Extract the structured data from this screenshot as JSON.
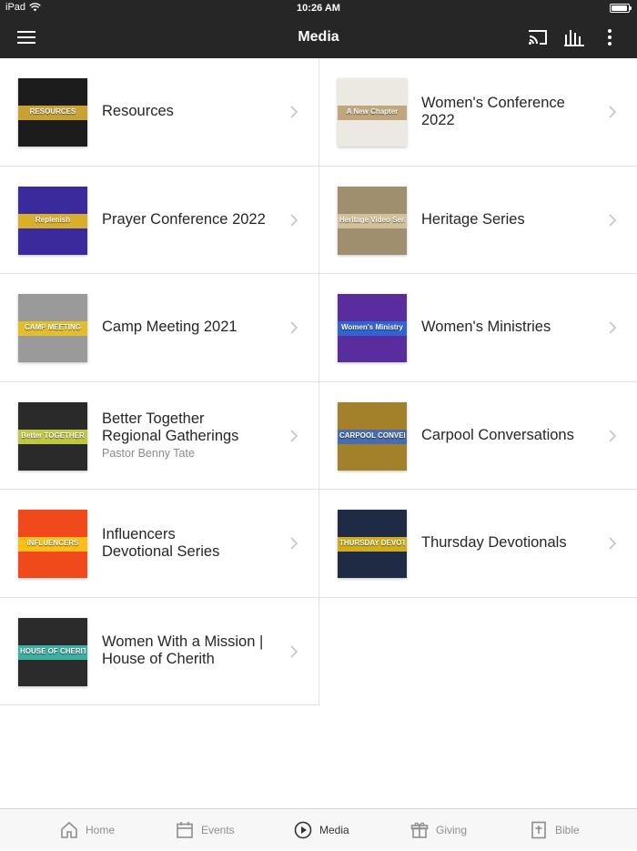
{
  "status": {
    "device": "iPad",
    "time": "10:26 AM"
  },
  "nav": {
    "title": "Media"
  },
  "left_items": [
    {
      "title": "Resources",
      "thumb_text": "RESOURCES",
      "thumb_bg": "#1c1c1c",
      "thumb_accent": "#e8b93a"
    },
    {
      "title": "Prayer Conference 2022",
      "thumb_text": "Replenish",
      "thumb_bg": "#3b2a9c",
      "thumb_accent": "#f5c61a"
    },
    {
      "title": "Camp Meeting 2021",
      "thumb_text": "CAMP MEETING",
      "thumb_bg": "#9a9a9a",
      "thumb_accent": "#f0c419"
    },
    {
      "title": "Better Together\nRegional Gatherings",
      "subtitle": "Pastor Benny Tate",
      "thumb_text": "Better TOGETHER",
      "thumb_bg": "#2a2a2a",
      "thumb_accent": "#d9e34a"
    },
    {
      "title": "Influencers\nDevotional Series",
      "thumb_text": "INFLUENCERS",
      "thumb_bg": "#f04a1c",
      "thumb_accent": "#ffd21a"
    },
    {
      "title": "Women With a Mission |\nHouse of Cherith",
      "thumb_text": "HOUSE OF CHERITH",
      "thumb_bg": "#2b2b2b",
      "thumb_accent": "#3fc7b8"
    }
  ],
  "right_items": [
    {
      "title": "Women's Conference\n2022",
      "thumb_text": "A New Chapter",
      "thumb_bg": "#ece8e2",
      "thumb_accent": "#b89a6a"
    },
    {
      "title": "Heritage Series",
      "thumb_text": "Heritage Video Series",
      "thumb_bg": "#a08f6e",
      "thumb_accent": "#d9c9a0"
    },
    {
      "title": "Women's Ministries",
      "thumb_text": "Women's Ministry",
      "thumb_bg": "#5a2d9e",
      "thumb_accent": "#2c6fd8"
    },
    {
      "title": "Carpool Conversations",
      "thumb_text": "CARPOOL CONVERSATIONS",
      "thumb_bg": "#a3802a",
      "thumb_accent": "#3a68c8"
    },
    {
      "title": "Thursday Devotionals",
      "thumb_text": "THURSDAY DEVOTIONAL SERIES",
      "thumb_bg": "#1f2b44",
      "thumb_accent": "#f0c419"
    }
  ],
  "tabs": [
    {
      "label": "Home",
      "icon": "home-icon",
      "active": false
    },
    {
      "label": "Events",
      "icon": "calendar-icon",
      "active": false
    },
    {
      "label": "Media",
      "icon": "play-icon",
      "active": true
    },
    {
      "label": "Giving",
      "icon": "gift-icon",
      "active": false
    },
    {
      "label": "Bible",
      "icon": "bible-icon",
      "active": false
    }
  ]
}
